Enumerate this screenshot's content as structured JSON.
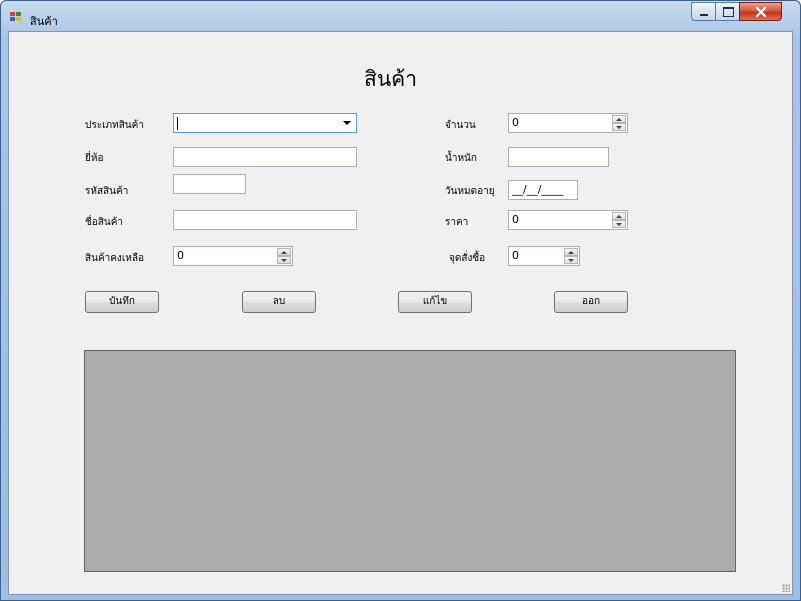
{
  "window": {
    "title": "สินค้า"
  },
  "form": {
    "heading": "สินค้า",
    "labels": {
      "category": "ประเภทสินค้า",
      "brand": "ยี่ห้อ",
      "code": "รหัสสินค้า",
      "name": "ชื่อสินค้า",
      "stock": "สินค้าคงเหลือ",
      "quantity": "จำนวน",
      "weight": "น้ำหนัก",
      "expiry": "วันหมดอายุ",
      "price": "ราคา",
      "reorder": "จุดสั่งซื้อ"
    },
    "values": {
      "category": "",
      "brand": "",
      "code": "",
      "name": "",
      "stock": "0",
      "quantity": "0",
      "weight": "",
      "expiry": "__/__/____",
      "price": "0",
      "reorder": "0"
    }
  },
  "buttons": {
    "save": "บันทึก",
    "delete": "ลบ",
    "edit": "แก้ไข",
    "exit": "ออก"
  },
  "colors": {
    "client_bg": "#f0f0f0",
    "grid_bg": "#ababab",
    "close_button": "#c0361b"
  }
}
